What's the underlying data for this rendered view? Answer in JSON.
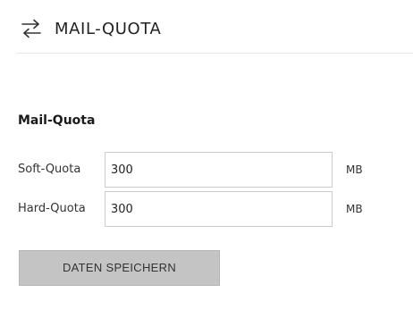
{
  "header": {
    "icon": "swap-arrows-icon",
    "title": "MAIL-QUOTA"
  },
  "section": {
    "title": "Mail-Quota"
  },
  "fields": {
    "soft": {
      "label": "Soft-Quota",
      "value": "300",
      "unit": "MB"
    },
    "hard": {
      "label": "Hard-Quota",
      "value": "300",
      "unit": "MB"
    }
  },
  "actions": {
    "save_label": "DATEN SPEICHERN"
  },
  "colors": {
    "button_background": "#c4c4c4",
    "input_border": "#cccccc",
    "divider": "#e8e8e8"
  }
}
